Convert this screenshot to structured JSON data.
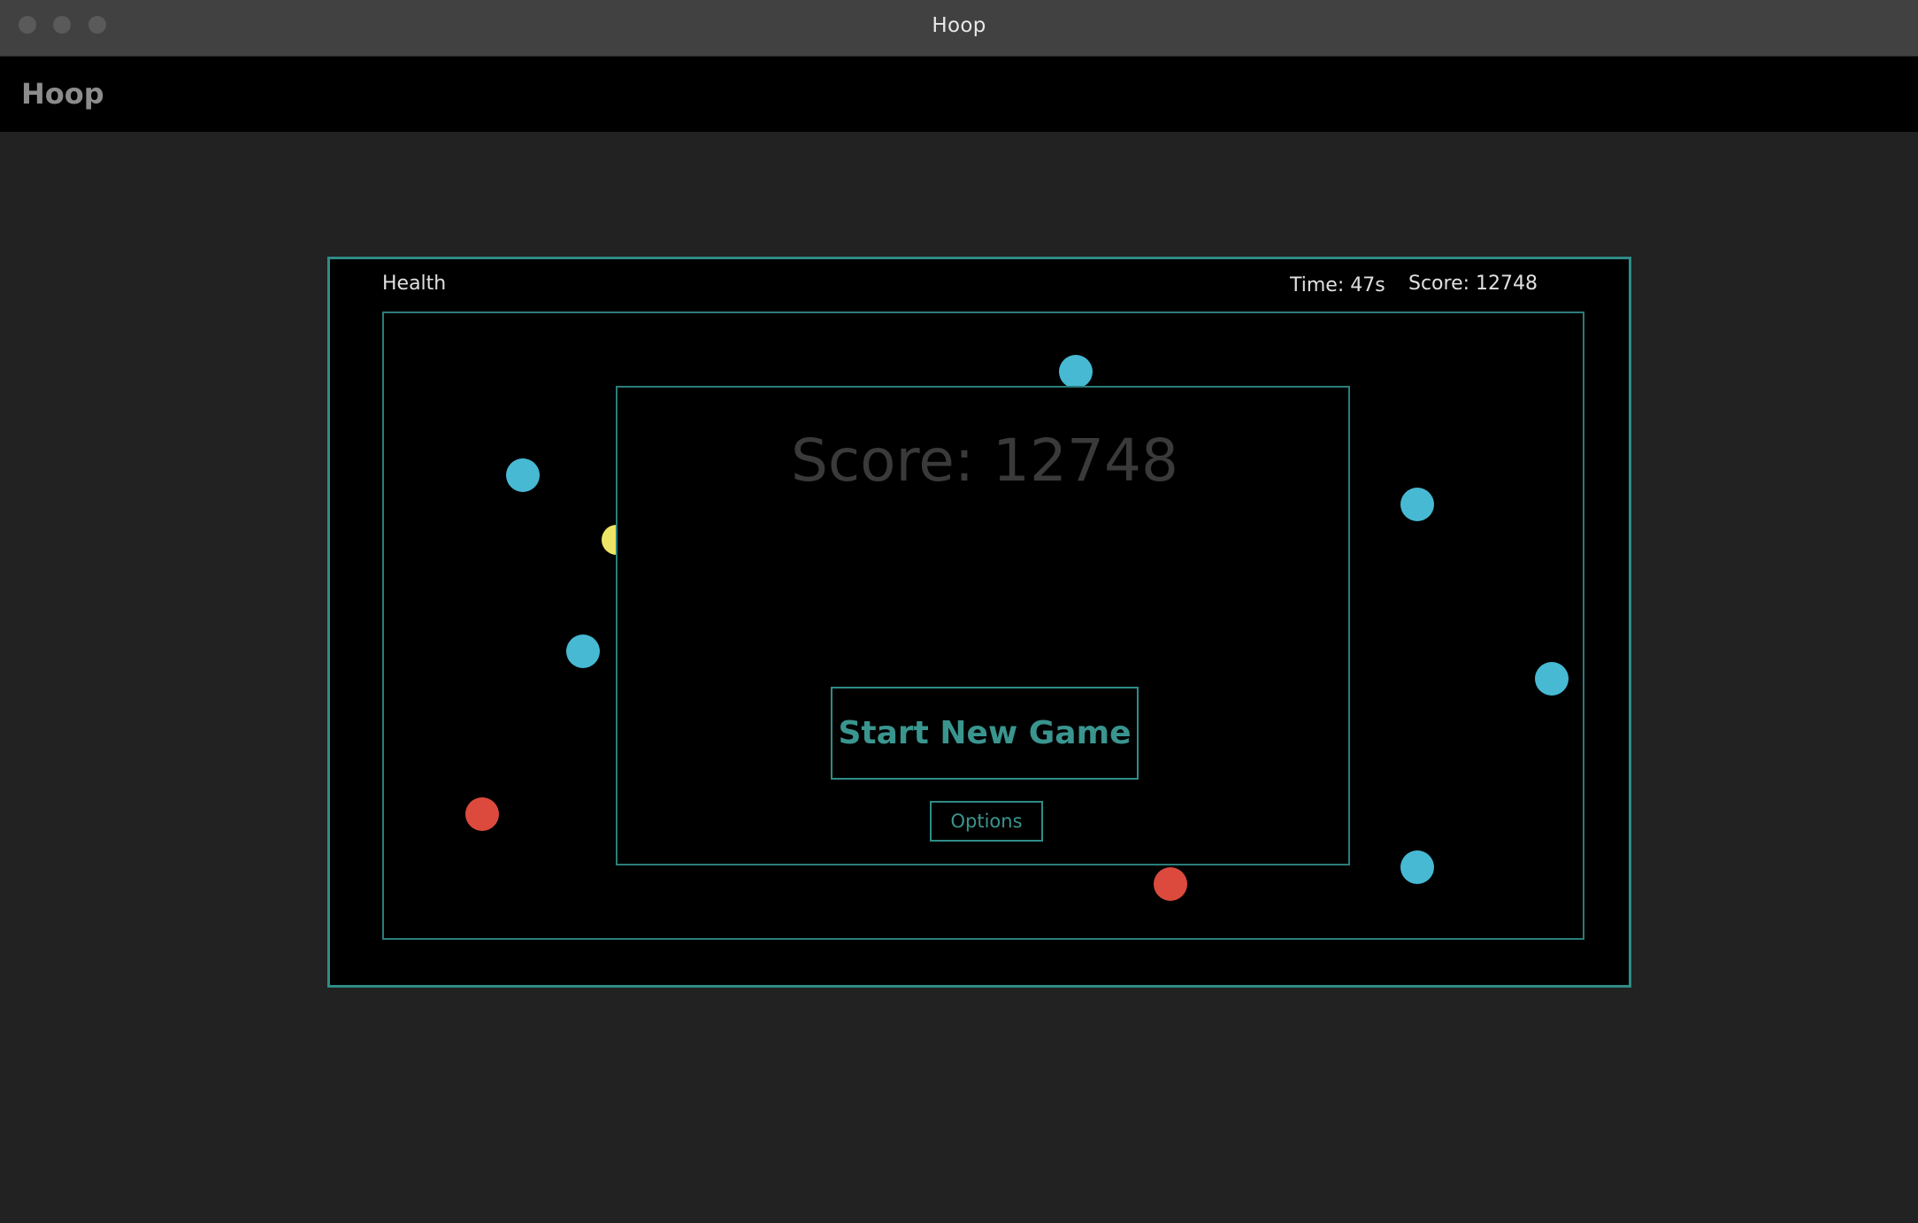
{
  "window": {
    "title": "Hoop"
  },
  "app": {
    "title": "Hoop"
  },
  "hud": {
    "health_label": "Health",
    "time": "Time: 47s",
    "score": "Score: 12748"
  },
  "overlay": {
    "score_text": "Score: 12748",
    "start_button": "Start New Game",
    "options_button": "Options"
  },
  "colors": {
    "accent": "#2f8c87",
    "blue_ball": "#47b9d3",
    "red_ball": "#dc4a3e",
    "yellow_ball": "#ede566"
  }
}
